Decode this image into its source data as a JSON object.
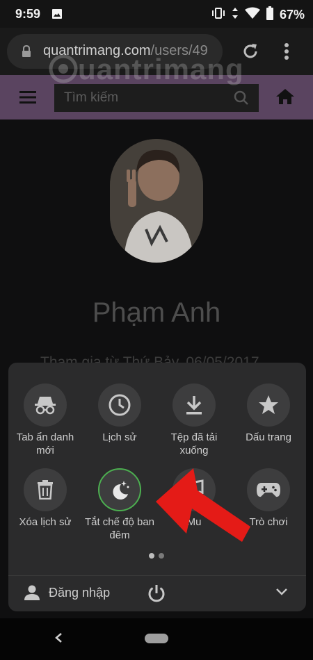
{
  "status_bar": {
    "time": "9:59",
    "battery": "67%"
  },
  "browser": {
    "url_host": "quantrimang.com",
    "url_path": "/users/49"
  },
  "site": {
    "search_placeholder": "Tìm kiếm",
    "logo_text": "uantrimang"
  },
  "profile": {
    "name": "Phạm Anh",
    "joined": "Tham gia từ Thứ Bảy, 06/05/2017"
  },
  "menu": {
    "items": [
      {
        "label": "Tab ẩn danh mới",
        "icon": "incognito-icon"
      },
      {
        "label": "Lịch sử",
        "icon": "history-icon"
      },
      {
        "label": "Tệp đã tải xuống",
        "icon": "download-icon"
      },
      {
        "label": "Dấu trang",
        "icon": "star-icon"
      },
      {
        "label": "Xóa lịch sử",
        "icon": "trash-icon"
      },
      {
        "label": "Tắt chế độ ban đêm",
        "icon": "night-mode-icon"
      },
      {
        "label": "Mu",
        "icon": "music-icon"
      },
      {
        "label": "Trò chơi",
        "icon": "gamepad-icon"
      }
    ],
    "login_label": "Đăng nhập",
    "page_count": 2,
    "current_page": 1
  },
  "colors": {
    "accent_active": "#4caf50",
    "header_purple": "#5a4460",
    "arrow_red": "#e41b17"
  }
}
